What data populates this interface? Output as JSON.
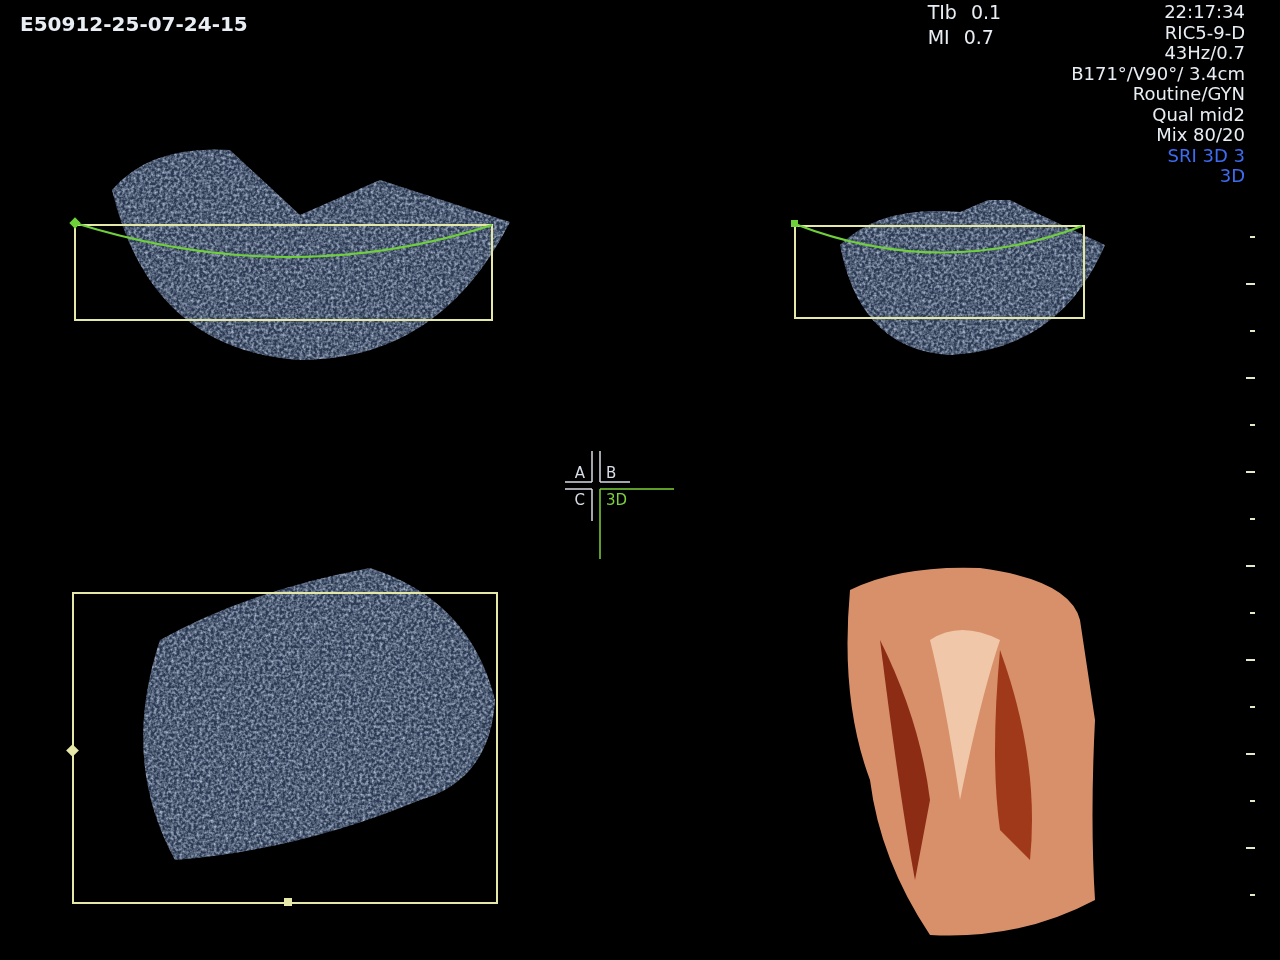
{
  "exam_id": "E50912-25-07-24-15",
  "acoustic": [
    {
      "label": "TIb",
      "value": "0.1"
    },
    {
      "label": "MI",
      "value": "0.7"
    }
  ],
  "info_lines": [
    {
      "text": "22:17:34",
      "color": "#e8eef4"
    },
    {
      "text": "RIC5-9-D",
      "color": "#e8eef4"
    },
    {
      "text": "43Hz/0.7",
      "color": "#e8eef4"
    },
    {
      "text": "B171°/V90°/ 3.4cm",
      "color": "#e8eef4"
    },
    {
      "text": "Routine/GYN",
      "color": "#e8eef4"
    },
    {
      "text": "Qual mid2",
      "color": "#e8eef4"
    },
    {
      "text": "Mix 80/20",
      "color": "#e8eef4"
    },
    {
      "text": "SRI 3D 3",
      "color": "#3d6cf0"
    },
    {
      "text": "3D",
      "color": "#3d6cf0"
    }
  ],
  "quadrants": [
    {
      "label": "A",
      "selected": false
    },
    {
      "label": "B",
      "selected": false
    },
    {
      "label": "C",
      "selected": false
    },
    {
      "label": "3D",
      "selected": true
    }
  ]
}
